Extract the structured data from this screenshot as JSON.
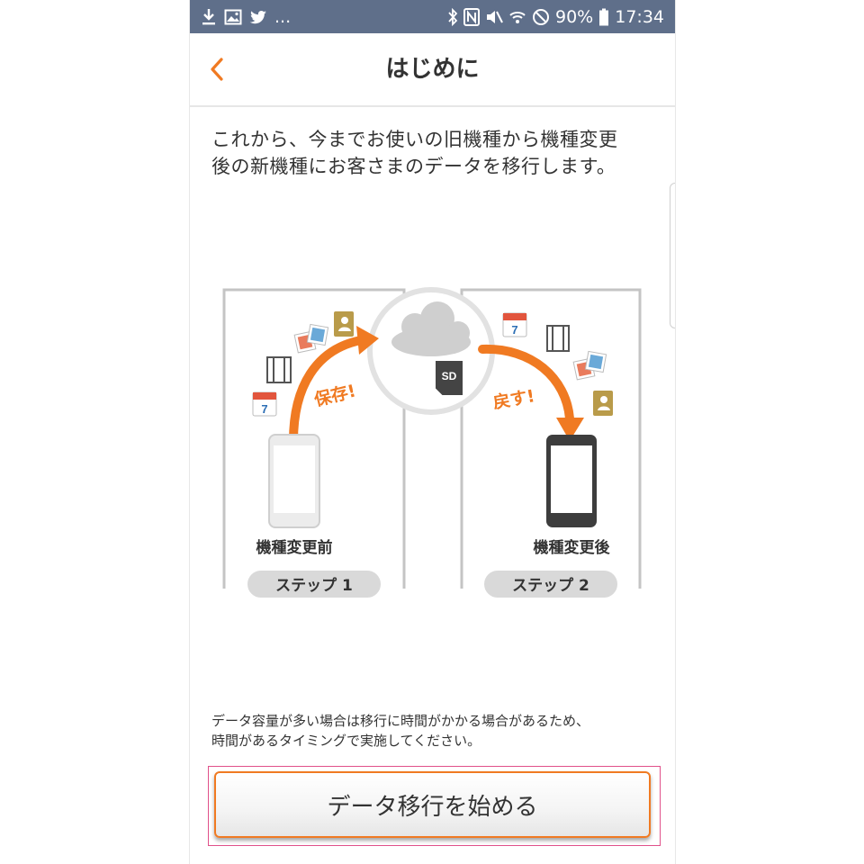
{
  "status_bar": {
    "left_icons": [
      "download-icon",
      "image-icon",
      "twitter-icon"
    ],
    "more": "...",
    "right_icons": [
      "bluetooth-icon",
      "nfc-icon",
      "mute-icon",
      "wifi-icon",
      "do-not-disturb-icon",
      "battery-icon"
    ],
    "battery": "90%",
    "time": "17:34"
  },
  "header": {
    "title": "はじめに",
    "back_icon": "chevron-left-icon",
    "accent_color": "#f07a22"
  },
  "intro": {
    "text": "これから、今までお使いの旧機種から機種変更\n後の新機種にお客さまのデータを移行します。"
  },
  "illustration": {
    "save_label": "保存!",
    "restore_label": "戻す!",
    "sd_label": "SD",
    "calendar_day": "7",
    "before_label": "機種変更前",
    "after_label": "機種変更後",
    "step1": "ステップ 1",
    "step2": "ステップ 2",
    "icons": [
      "cloud-icon",
      "sd-card-icon",
      "calendar-icon",
      "film-icon",
      "photo-icon",
      "contacts-icon",
      "old-phone-icon",
      "new-phone-icon"
    ]
  },
  "note": {
    "text": "データ容量が多い場合は移行に時間がかかる場合があるため、\n時間があるタイミングで実施してください。"
  },
  "start_button": {
    "label": "データ移行を始める"
  },
  "colors": {
    "status_bar": "#5f6f8a",
    "accent": "#f07a22",
    "button_outline": "#e0508a"
  }
}
